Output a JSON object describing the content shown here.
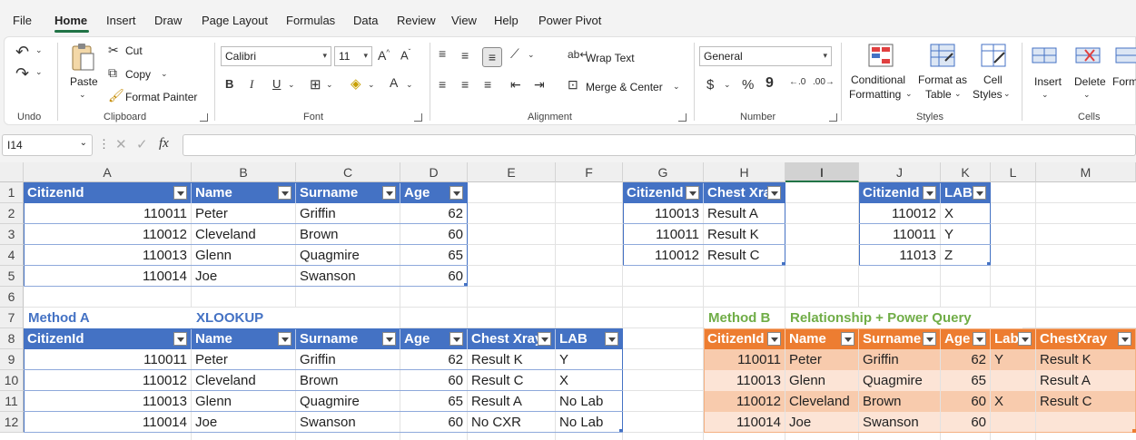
{
  "menu": {
    "items": [
      "File",
      "Home",
      "Insert",
      "Draw",
      "Page Layout",
      "Formulas",
      "Data",
      "Review",
      "View",
      "Help",
      "Power Pivot"
    ],
    "active": "Home"
  },
  "ribbon": {
    "undo_group": "Undo",
    "clipboard": {
      "paste": "Paste",
      "cut": "Cut",
      "copy": "Copy",
      "format_painter": "Format Painter",
      "label": "Clipboard"
    },
    "font": {
      "name": "Calibri",
      "size": "11",
      "label": "Font",
      "bold": "B",
      "italic": "I",
      "underline": "U"
    },
    "alignment": {
      "wrap_text": "Wrap Text",
      "merge_center": "Merge & Center",
      "label": "Alignment"
    },
    "number": {
      "format": "General",
      "label": "Number",
      "currency": "$",
      "percent": "%",
      "comma": "9"
    },
    "styles": {
      "conditional": "Conditional",
      "formatting": "Formatting",
      "format_as": "Format as",
      "table": "Table",
      "cell": "Cell",
      "styles_btn": "Styles",
      "label": "Styles"
    },
    "cells": {
      "insert": "Insert",
      "delete": "Delete",
      "format": "Forma",
      "label": "Cells"
    }
  },
  "formula_bar": {
    "name_box": "I14",
    "fx": "fx",
    "value": ""
  },
  "columns": [
    "A",
    "B",
    "C",
    "D",
    "E",
    "F",
    "G",
    "H",
    "I",
    "J",
    "K",
    "L",
    "M"
  ],
  "selected_column": "I",
  "rows": [
    "1",
    "2",
    "3",
    "4",
    "5",
    "6",
    "7",
    "8",
    "9",
    "10",
    "11",
    "12"
  ],
  "table1": {
    "headers": [
      "CitizenId",
      "Name",
      "Surname",
      "Age"
    ],
    "rows": [
      [
        "110011",
        "Peter",
        "Griffin",
        "62"
      ],
      [
        "110012",
        "Cleveland",
        "Brown",
        "60"
      ],
      [
        "110013",
        "Glenn",
        "Quagmire",
        "65"
      ],
      [
        "110014",
        "Joe",
        "Swanson",
        "60"
      ]
    ]
  },
  "table2": {
    "headers": [
      "CitizenId",
      "Chest Xray"
    ],
    "rows": [
      [
        "110013",
        "Result A"
      ],
      [
        "110011",
        "Result K"
      ],
      [
        "110012",
        "Result C"
      ]
    ]
  },
  "table3": {
    "headers": [
      "CitizenId",
      "LAB"
    ],
    "rows": [
      [
        "110012",
        "X"
      ],
      [
        "110011",
        "Y"
      ],
      [
        "11013",
        "Z"
      ]
    ]
  },
  "method_a": {
    "title": "Method A",
    "subtitle": "XLOOKUP",
    "headers": [
      "CitizenId",
      "Name",
      "Surname",
      "Age",
      "Chest Xray",
      "LAB"
    ],
    "rows": [
      [
        "110011",
        "Peter",
        "Griffin",
        "62",
        "Result K",
        "Y"
      ],
      [
        "110012",
        "Cleveland",
        "Brown",
        "60",
        "Result C",
        "X"
      ],
      [
        "110013",
        "Glenn",
        "Quagmire",
        "65",
        "Result A",
        "No Lab"
      ],
      [
        "110014",
        "Joe",
        "Swanson",
        "60",
        "No CXR",
        "No Lab"
      ]
    ]
  },
  "method_b": {
    "title": "Method B",
    "subtitle": "Relationship + Power Query",
    "headers": [
      "CitizenId",
      "Name",
      "Surname",
      "Age",
      "Lab",
      "ChestXray"
    ],
    "rows": [
      [
        "110011",
        "Peter",
        "Griffin",
        "62",
        "Y",
        "Result K"
      ],
      [
        "110013",
        "Glenn",
        "Quagmire",
        "65",
        "",
        "Result A"
      ],
      [
        "110012",
        "Cleveland",
        "Brown",
        "60",
        "X",
        "Result C"
      ],
      [
        "110014",
        "Joe",
        "Swanson",
        "60",
        "",
        ""
      ]
    ]
  },
  "colors": {
    "accent": "#217346",
    "table_blue": "#4472c4",
    "table_orange": "#ed7d31",
    "band1": "#f8cbad",
    "band2": "#fce4d6",
    "green_title": "#70ad47"
  }
}
